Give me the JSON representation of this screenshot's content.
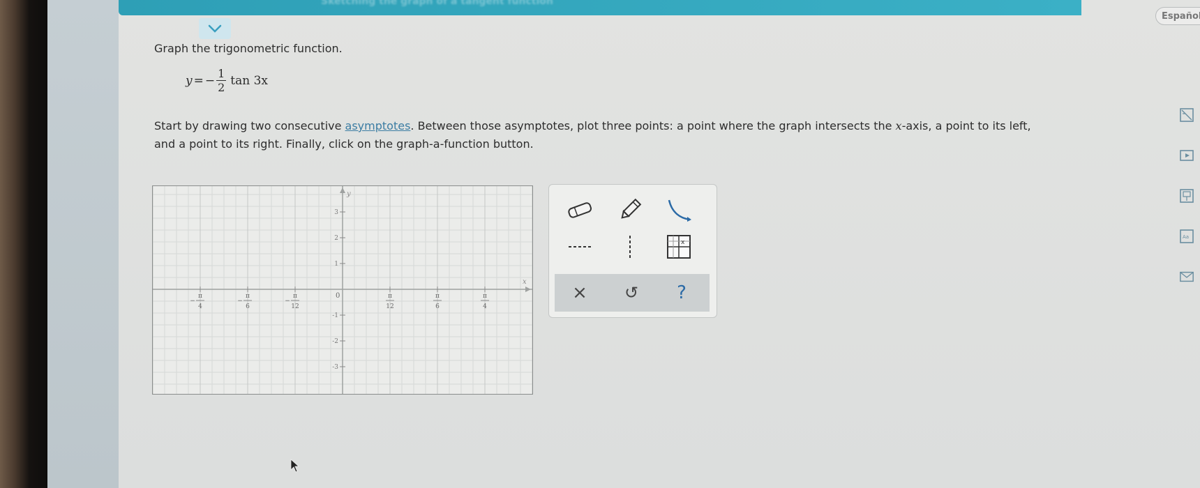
{
  "header": {
    "banner_title": "Sketching the graph of a tangent function",
    "language_button": "Español"
  },
  "problem": {
    "instruction": "Graph the trigonometric function.",
    "equation": {
      "lhs": "y",
      "equals": "=",
      "sign": "−",
      "numerator": "1",
      "denominator": "2",
      "rhs": "tan 3x"
    },
    "directions_before_link": "Start by drawing two consecutive ",
    "directions_link": "asymptotes",
    "directions_after_link_1": ". Between those asymptotes, plot three points: a point where the graph intersects the ",
    "directions_x": "x",
    "directions_after_link_2": "-axis, a point to its left,",
    "directions_line2": "and a point to its right. Finally, click on the graph-a-function button."
  },
  "graph": {
    "x_axis_label": "x",
    "y_axis_label": "y",
    "origin_label": "0",
    "x_tick_labels": [
      {
        "sign": "−",
        "num": "π",
        "den": "4"
      },
      {
        "sign": "−",
        "num": "π",
        "den": "6"
      },
      {
        "sign": "−",
        "num": "π",
        "den": "12"
      },
      {
        "sign": "",
        "num": "π",
        "den": "12"
      },
      {
        "sign": "",
        "num": "π",
        "den": "6"
      },
      {
        "sign": "",
        "num": "π",
        "den": "4"
      }
    ],
    "y_tick_labels": [
      "3",
      "2",
      "1",
      "-1",
      "-2",
      "-3"
    ]
  },
  "tools": {
    "eraser": "eraser-tool",
    "pencil": "pencil-tool",
    "curve": "graph-a-function-tool",
    "dashed_line": "asymptote-tool",
    "vertical_dashed": "vertical-asymptote-tool",
    "table": "table-tool",
    "clear_symbol": "×",
    "undo_symbol": "↺",
    "help_symbol": "?"
  },
  "colors": {
    "banner": "#34a8bf",
    "link": "#3b7da3",
    "text": "#2d2d2d"
  }
}
